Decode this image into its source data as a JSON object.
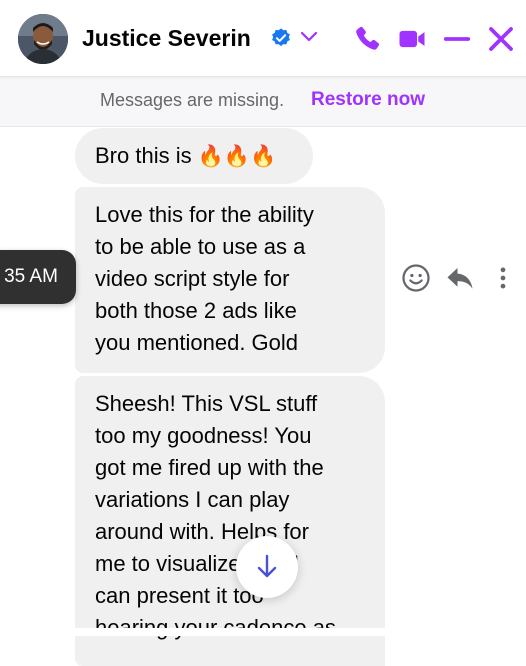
{
  "header": {
    "contact_name": "Justice Severin",
    "icons": [
      "verified-badge-icon",
      "chevron-down-icon",
      "phone-icon",
      "video-call-icon",
      "minimize-icon",
      "close-icon"
    ],
    "accent_color": "#a033ff",
    "verified_color": "#1877f2"
  },
  "notice": {
    "text": "Messages are missing.",
    "action_label": "Restore now"
  },
  "messages": [
    {
      "text": "Bro this is",
      "emoji": "🔥🔥🔥"
    },
    {
      "lines": [
        "Love this for the ability",
        "to be able to use as a",
        "video script style for",
        "both those 2 ads like",
        "you mentioned. Gold"
      ]
    },
    {
      "lines": [
        "Sheesh! This VSL stuff",
        "too my goodness! You",
        "got me fired up with the",
        "variations I can play",
        "around with. Helps for",
        "me to visualize how I",
        "can present it too",
        "hearing your cadence as"
      ]
    }
  ],
  "timestamp_tooltip": "35 AM",
  "message_actions": [
    "react-smiley-icon",
    "reply-icon",
    "more-options-icon"
  ],
  "scroll_button_icon": "arrow-down-icon"
}
